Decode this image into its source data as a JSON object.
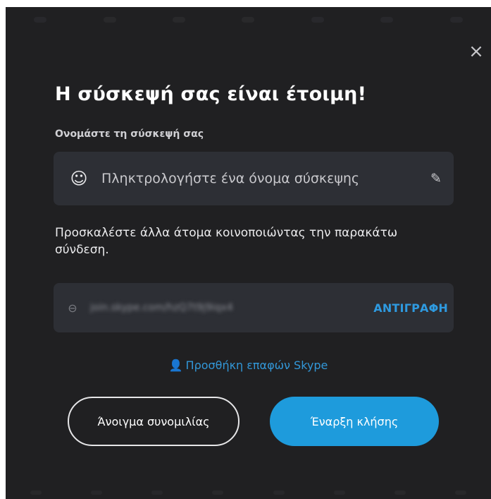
{
  "dialog": {
    "close_icon": "×",
    "title": "Η σύσκεψή σας είναι έτοιμη!",
    "name_section": {
      "label": "Ονομάστε τη σύσκεψή σας",
      "input_placeholder": "Πληκτρολογήστε ένα όνομα σύσκεψης",
      "input_value": "",
      "emoji_icon": "☺",
      "edit_icon": "✎"
    },
    "invite": {
      "text": "Προσκαλέστε άλλα άτομα κοινοποιώντας την παρακάτω σύνδεση.",
      "link_icon": "⊖",
      "link_url": "join.skype.com/hzQ7t9j9iqx4",
      "copy_label": "ΑΝΤΙΓΡΑΦΗ"
    },
    "add_contacts": {
      "icon": "👤",
      "label": "Προσθήκη επαφών Skype"
    },
    "buttons": {
      "open_chat": "Άνοιγμα συνομιλίας",
      "start_call": "Έναρξη κλήσης"
    }
  },
  "colors": {
    "background": "#202022",
    "field": "#2d2f35",
    "accent": "#1e9bdc",
    "link": "#3297d8"
  }
}
